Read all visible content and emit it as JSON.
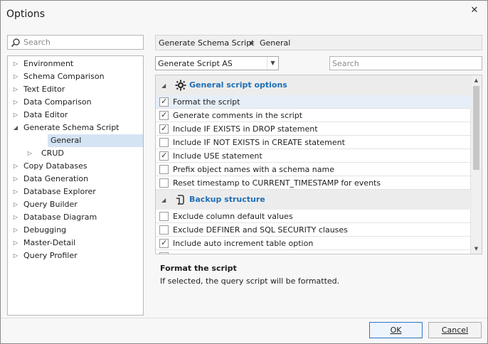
{
  "window": {
    "title": "Options",
    "close_glyph": "✕"
  },
  "search_left": {
    "placeholder": "Search",
    "value": ""
  },
  "tree": {
    "items": [
      {
        "label": "Environment",
        "expanded": false,
        "level": 0
      },
      {
        "label": "Schema Comparison",
        "expanded": false,
        "level": 0
      },
      {
        "label": "Text Editor",
        "expanded": false,
        "level": 0
      },
      {
        "label": "Data Comparison",
        "expanded": false,
        "level": 0
      },
      {
        "label": "Data Editor",
        "expanded": false,
        "level": 0
      },
      {
        "label": "Generate Schema Script",
        "expanded": true,
        "level": 0
      },
      {
        "label": "General",
        "level": 1,
        "selected": true
      },
      {
        "label": "CRUD",
        "expanded": false,
        "level": 1
      },
      {
        "label": "Copy Databases",
        "expanded": false,
        "level": 0
      },
      {
        "label": "Data Generation",
        "expanded": false,
        "level": 0
      },
      {
        "label": "Database Explorer",
        "expanded": false,
        "level": 0
      },
      {
        "label": "Query Builder",
        "expanded": false,
        "level": 0
      },
      {
        "label": "Database Diagram",
        "expanded": false,
        "level": 0
      },
      {
        "label": "Debugging",
        "expanded": false,
        "level": 0
      },
      {
        "label": "Master-Detail",
        "expanded": false,
        "level": 0
      },
      {
        "label": "Query Profiler",
        "expanded": false,
        "level": 0
      }
    ]
  },
  "breadcrumb": {
    "parent": "Generate Schema Script",
    "current": "General"
  },
  "combo": {
    "value": "Generate Script AS"
  },
  "search_right": {
    "placeholder": "Search",
    "value": ""
  },
  "groups": [
    {
      "title": "General script options",
      "icon": "gear-icon",
      "options": [
        {
          "label": "Format the script",
          "checked": true,
          "selected": true
        },
        {
          "label": "Generate comments in the script",
          "checked": true
        },
        {
          "label": "Include IF EXISTS in DROP statement",
          "checked": true
        },
        {
          "label": "Include IF NOT EXISTS in CREATE statement",
          "checked": false
        },
        {
          "label": "Include USE statement",
          "checked": true
        },
        {
          "label": "Prefix object names with a schema name",
          "checked": false
        },
        {
          "label": "Reset timestamp to CURRENT_TIMESTAMP for events",
          "checked": false
        }
      ]
    },
    {
      "title": "Backup structure",
      "icon": "structure-icon",
      "options": [
        {
          "label": "Exclude column default values",
          "checked": false
        },
        {
          "label": "Exclude DEFINER and SQL SECURITY clauses",
          "checked": false
        },
        {
          "label": "Include auto increment table option",
          "checked": true
        },
        {
          "label": "",
          "checked": true
        }
      ]
    }
  ],
  "description": {
    "title": "Format the script",
    "text": "If selected, the query script will be formatted."
  },
  "buttons": {
    "ok": "OK",
    "cancel": "Cancel"
  },
  "colors": {
    "accent": "#1f6fb5",
    "selection": "#d5e4f3",
    "ok_border": "#2f74c6"
  }
}
